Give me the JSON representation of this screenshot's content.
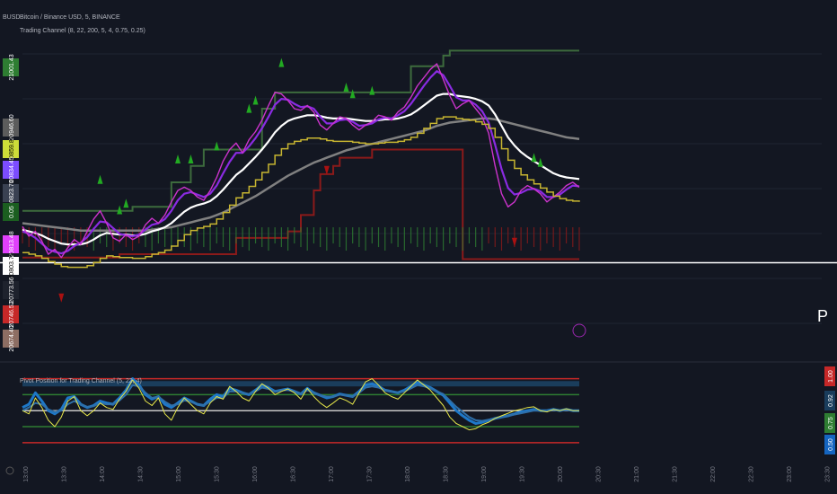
{
  "header": {
    "symbol_code": "BUSD",
    "title": "Bitcoin / Binance USD, 5, BINANCE",
    "indicator": "Trading Channel (8, 22, 200, 5, 4, 0.75, 0.25)",
    "osc_title": "Pivot Position for Trading Channel (5, 22, 4)",
    "p_mark": "P"
  },
  "colors": {
    "background": "#131722",
    "grid": "#1f2633",
    "price": "#ffffff",
    "magenta": "#cc33cc",
    "purple": "#8a2be2",
    "gold": "#c7b531",
    "gray": "#808080",
    "green_level": "#3d6b3d",
    "red_level": "#8b1a1a",
    "brown_level": "#a07878",
    "arrow_up": "#22aa22",
    "arrow_down": "#aa1111",
    "osc_blue": "#1e78c8",
    "osc_yellow": "#e6e64a",
    "osc_white": "#c8c8c8"
  },
  "price_tags": [
    {
      "text": "21001.43",
      "bg": "#2e7d32",
      "fg": "#ffffff"
    },
    {
      "text": "20946.60",
      "bg": "#5c5c5c",
      "fg": "#ffffff"
    },
    {
      "text": "20859.87",
      "bg": "#cddc39",
      "fg": "#000000"
    },
    {
      "text": "20834.45",
      "bg": "#7c4dff",
      "fg": "#ffffff"
    },
    {
      "text": "20823.76",
      "bg": "#3a4152",
      "fg": "#ffffff"
    },
    {
      "text": "0.05",
      "bg": "#1b5e20",
      "fg": "#ffffff"
    },
    {
      "text": "20813.48",
      "bg": "#e040fb",
      "fg": "#ffffff"
    },
    {
      "text": "20803.75",
      "bg": "#ffffff",
      "fg": "#000000"
    },
    {
      "text": "20773.56",
      "bg": "#1e222d",
      "fg": "#ffffff"
    },
    {
      "text": "20746.52",
      "bg": "#c62828",
      "fg": "#ffffff"
    },
    {
      "text": "20674.40",
      "bg": "#8d6e63",
      "fg": "#ffffff"
    }
  ],
  "osc_tags": [
    {
      "text": "1.00",
      "bg": "#c62828",
      "fg": "#ffffff"
    },
    {
      "text": "0.92",
      "bg": "#1a3d5c",
      "fg": "#ffffff"
    },
    {
      "text": "0.75",
      "bg": "#2e7d32",
      "fg": "#ffffff"
    },
    {
      "text": "0.50",
      "bg": "#1565c0",
      "fg": "#ffffff"
    }
  ],
  "chart_data": {
    "type": "line",
    "title": "Bitcoin / Binance USD, 5, BINANCE",
    "x_ticks": [
      "13:00",
      "13:30",
      "14:00",
      "14:30",
      "15:00",
      "15:30",
      "16:00",
      "16:30",
      "17:00",
      "17:30",
      "18:00",
      "18:30",
      "19:00",
      "19:30",
      "20:00",
      "20:30",
      "21:00",
      "21:30",
      "22:00",
      "22:30",
      "23:00",
      "23:30"
    ],
    "x": [
      0,
      5,
      10,
      15,
      20,
      25,
      30,
      35,
      40,
      45,
      50,
      55,
      60,
      65,
      70,
      75,
      80,
      85,
      90,
      95,
      100,
      105,
      110,
      115,
      120,
      125,
      130,
      135,
      140,
      145,
      150,
      155,
      160,
      165,
      170,
      175,
      180,
      185,
      190,
      195,
      200,
      205,
      210,
      215,
      220,
      225,
      230,
      235,
      240,
      245,
      250,
      255,
      260,
      265,
      270,
      275,
      280,
      285,
      290,
      295,
      300,
      305,
      310,
      315,
      320,
      325,
      330,
      335,
      340,
      345,
      350,
      355,
      360,
      365,
      370,
      375,
      380,
      385,
      390,
      395,
      400,
      405,
      410,
      415,
      420,
      425,
      430
    ],
    "price_ylim": [
      20640,
      21030
    ],
    "series": [
      {
        "name": "price",
        "values": [
          20786,
          20774,
          20780,
          20768,
          20752,
          20758,
          20748,
          20760,
          20770,
          20764,
          20780,
          20795,
          20805,
          20790,
          20772,
          20768,
          20776,
          20770,
          20774,
          20788,
          20796,
          20790,
          20800,
          20816,
          20830,
          20834,
          20830,
          20822,
          20818,
          20830,
          20846,
          20866,
          20880,
          20888,
          20876,
          20892,
          20902,
          20916,
          20934,
          20950,
          20948,
          20940,
          20930,
          20928,
          20934,
          20926,
          20910,
          20904,
          20912,
          20920,
          20918,
          20910,
          20904,
          20910,
          20914,
          20922,
          20920,
          20916,
          20926,
          20932,
          20944,
          20958,
          20968,
          20978,
          20985,
          20966,
          20946,
          20930,
          20936,
          20940,
          20930,
          20920,
          20900,
          20860,
          20826,
          20810,
          20816,
          20830,
          20836,
          20832,
          20826,
          20816,
          20822,
          20828,
          20836,
          20840,
          20834
        ]
      },
      {
        "name": "ema-fast",
        "values": [
          20780,
          20777,
          20772,
          20765,
          20758,
          20755,
          20753,
          20756,
          20762,
          20766,
          20773,
          20783,
          20792,
          20791,
          20784,
          20777,
          20775,
          20774,
          20776,
          20782,
          20788,
          20790,
          20795,
          20805,
          20818,
          20826,
          20828,
          20825,
          20822,
          20826,
          20836,
          20851,
          20865,
          20876,
          20876,
          20884,
          20894,
          20906,
          20920,
          20935,
          20942,
          20941,
          20936,
          20932,
          20933,
          20930,
          20920,
          20912,
          20912,
          20916,
          20917,
          20914,
          20909,
          20910,
          20912,
          20917,
          20919,
          20918,
          20922,
          20927,
          20936,
          20947,
          20958,
          20968,
          20976,
          20971,
          20958,
          20944,
          20940,
          20940,
          20935,
          20927,
          20913,
          20886,
          20856,
          20833,
          20825,
          20827,
          20831,
          20832,
          20829,
          20822,
          20822,
          20825,
          20831,
          20836,
          20835
        ]
      },
      {
        "name": "ema-mid",
        "values": [
          20782,
          20780,
          20778,
          20775,
          20771,
          20768,
          20765,
          20764,
          20764,
          20764,
          20766,
          20770,
          20775,
          20778,
          20777,
          20776,
          20776,
          20775,
          20775,
          20777,
          20780,
          20782,
          20785,
          20790,
          20797,
          20804,
          20809,
          20812,
          20814,
          20817,
          20823,
          20831,
          20840,
          20849,
          20855,
          20863,
          20871,
          20880,
          20890,
          20901,
          20909,
          20915,
          20918,
          20920,
          20922,
          20922,
          20921,
          20919,
          20918,
          20918,
          20918,
          20917,
          20916,
          20915,
          20915,
          20916,
          20917,
          20917,
          20918,
          20920,
          20923,
          20928,
          20934,
          20940,
          20946,
          20948,
          20948,
          20946,
          20945,
          20944,
          20942,
          20939,
          20934,
          20923,
          20909,
          20895,
          20885,
          20877,
          20871,
          20866,
          20861,
          20856,
          20851,
          20848,
          20846,
          20845,
          20844
        ]
      },
      {
        "name": "ema-slow",
        "values": [
          20790,
          20789,
          20788,
          20787,
          20786,
          20785,
          20784,
          20783,
          20782,
          20781,
          20781,
          20781,
          20781,
          20781,
          20781,
          20781,
          20781,
          20781,
          20781,
          20781,
          20782,
          20783,
          20784,
          20785,
          20787,
          20789,
          20791,
          20793,
          20795,
          20797,
          20800,
          20803,
          20807,
          20811,
          20815,
          20819,
          20823,
          20828,
          20833,
          20838,
          20843,
          20848,
          20852,
          20856,
          20860,
          20864,
          20867,
          20870,
          20873,
          20876,
          20879,
          20881,
          20883,
          20885,
          20887,
          20889,
          20891,
          20893,
          20895,
          20897,
          20899,
          20901,
          20903,
          20906,
          20909,
          20911,
          20913,
          20914,
          20915,
          20916,
          20917,
          20918,
          20918,
          20917,
          20915,
          20913,
          20911,
          20909,
          20907,
          20905,
          20903,
          20901,
          20899,
          20897,
          20895,
          20894,
          20893
        ]
      }
    ],
    "levels": [
      {
        "name": "upper-green",
        "values": [
          20805,
          20805,
          20805,
          20805,
          20805,
          20805,
          20805,
          20805,
          20805,
          20805,
          20805,
          20805,
          20805,
          20805,
          20805,
          20805,
          20805,
          20810,
          20810,
          20810,
          20810,
          20810,
          20810,
          20840,
          20840,
          20840,
          20860,
          20860,
          20880,
          20880,
          20880,
          20880,
          20880,
          20880,
          20880,
          20880,
          20880,
          20930,
          20930,
          20950,
          20950,
          20950,
          20950,
          20950,
          20950,
          20950,
          20950,
          20950,
          20950,
          20950,
          20950,
          20950,
          20950,
          20950,
          20950,
          20950,
          20950,
          20950,
          20950,
          20950,
          20982,
          20982,
          20982,
          20982,
          20982,
          20995,
          21001,
          21001,
          21001,
          21001,
          21001,
          21001,
          21001,
          21001,
          21001,
          21001,
          21001,
          21001,
          21001,
          21001,
          21001,
          21001,
          21001,
          21001,
          21001,
          21001,
          21001
        ]
      },
      {
        "name": "lower-red",
        "values": [
          20748,
          20748,
          20748,
          20748,
          20748,
          20748,
          20748,
          20748,
          20748,
          20748,
          20748,
          20748,
          20748,
          20748,
          20748,
          20752,
          20752,
          20752,
          20752,
          20752,
          20752,
          20752,
          20752,
          20752,
          20752,
          20752,
          20752,
          20752,
          20752,
          20752,
          20752,
          20752,
          20752,
          20772,
          20772,
          20772,
          20772,
          20772,
          20772,
          20772,
          20772,
          20780,
          20780,
          20800,
          20800,
          20830,
          20850,
          20850,
          20860,
          20870,
          20870,
          20870,
          20870,
          20870,
          20880,
          20880,
          20880,
          20880,
          20880,
          20880,
          20880,
          20880,
          20880,
          20880,
          20880,
          20880,
          20880,
          20880,
          20746,
          20746,
          20746,
          20746,
          20746,
          20746,
          20746,
          20746,
          20746,
          20746,
          20746,
          20746,
          20746,
          20746,
          20746,
          20746,
          20746,
          20746,
          20746
        ]
      }
    ],
    "signals": [
      {
        "x": 30,
        "dir": "down"
      },
      {
        "x": 60,
        "dir": "up"
      },
      {
        "x": 75,
        "dir": "up"
      },
      {
        "x": 80,
        "dir": "up"
      },
      {
        "x": 120,
        "dir": "up"
      },
      {
        "x": 130,
        "dir": "up"
      },
      {
        "x": 150,
        "dir": "up"
      },
      {
        "x": 175,
        "dir": "up"
      },
      {
        "x": 180,
        "dir": "up"
      },
      {
        "x": 200,
        "dir": "up"
      },
      {
        "x": 235,
        "dir": "down"
      },
      {
        "x": 250,
        "dir": "up"
      },
      {
        "x": 255,
        "dir": "up"
      },
      {
        "x": 270,
        "dir": "up"
      },
      {
        "x": 380,
        "dir": "down"
      },
      {
        "x": 395,
        "dir": "up"
      },
      {
        "x": 400,
        "dir": "up"
      }
    ],
    "oscillator": {
      "ylim": [
        -0.1,
        1.05
      ],
      "levels": [
        1.0,
        0.92,
        0.75,
        0.5,
        0.25,
        0.0
      ],
      "series": [
        {
          "name": "osc-line",
          "values": [
            0.55,
            0.6,
            0.78,
            0.65,
            0.5,
            0.45,
            0.52,
            0.7,
            0.72,
            0.6,
            0.55,
            0.58,
            0.65,
            0.62,
            0.6,
            0.7,
            0.82,
            1.0,
            0.9,
            0.75,
            0.68,
            0.72,
            0.6,
            0.55,
            0.62,
            0.7,
            0.65,
            0.6,
            0.58,
            0.68,
            0.75,
            0.72,
            0.85,
            0.82,
            0.78,
            0.75,
            0.82,
            0.9,
            0.86,
            0.8,
            0.82,
            0.84,
            0.8,
            0.76,
            0.85,
            0.78,
            0.74,
            0.7,
            0.72,
            0.76,
            0.74,
            0.72,
            0.8,
            0.9,
            0.92,
            0.88,
            0.82,
            0.8,
            0.78,
            0.82,
            0.88,
            0.94,
            0.9,
            0.86,
            0.8,
            0.74,
            0.62,
            0.5,
            0.42,
            0.35,
            0.3,
            0.32,
            0.35,
            0.38,
            0.4,
            0.42,
            0.45,
            0.48,
            0.5,
            0.52,
            0.5,
            0.5,
            0.52,
            0.5,
            0.52,
            0.5,
            0.5
          ]
        },
        {
          "name": "osc-signal",
          "values": [
            0.5,
            0.55,
            0.62,
            0.6,
            0.52,
            0.48,
            0.5,
            0.6,
            0.65,
            0.6,
            0.56,
            0.57,
            0.62,
            0.6,
            0.6,
            0.66,
            0.75,
            0.9,
            0.88,
            0.78,
            0.7,
            0.72,
            0.64,
            0.58,
            0.6,
            0.66,
            0.64,
            0.6,
            0.58,
            0.64,
            0.7,
            0.7,
            0.8,
            0.8,
            0.78,
            0.76,
            0.8,
            0.86,
            0.84,
            0.8,
            0.82,
            0.82,
            0.8,
            0.76,
            0.82,
            0.78,
            0.74,
            0.72,
            0.72,
            0.75,
            0.74,
            0.72,
            0.78,
            0.86,
            0.88,
            0.86,
            0.82,
            0.8,
            0.78,
            0.8,
            0.85,
            0.9,
            0.88,
            0.85,
            0.8,
            0.76,
            0.66,
            0.56,
            0.48,
            0.4,
            0.35,
            0.34,
            0.36,
            0.38,
            0.4,
            0.42,
            0.44,
            0.46,
            0.48,
            0.5,
            0.5,
            0.5,
            0.51,
            0.5,
            0.51,
            0.5,
            0.5
          ]
        },
        {
          "name": "osc-fast",
          "values": [
            0.5,
            0.45,
            0.7,
            0.55,
            0.35,
            0.25,
            0.4,
            0.65,
            0.72,
            0.5,
            0.42,
            0.5,
            0.62,
            0.55,
            0.52,
            0.68,
            0.8,
            0.98,
            0.85,
            0.65,
            0.58,
            0.7,
            0.45,
            0.35,
            0.55,
            0.7,
            0.6,
            0.5,
            0.45,
            0.62,
            0.72,
            0.68,
            0.88,
            0.8,
            0.7,
            0.65,
            0.8,
            0.92,
            0.85,
            0.75,
            0.8,
            0.84,
            0.78,
            0.68,
            0.85,
            0.72,
            0.62,
            0.55,
            0.62,
            0.7,
            0.66,
            0.6,
            0.78,
            0.95,
            1.0,
            0.9,
            0.78,
            0.72,
            0.68,
            0.78,
            0.88,
            0.98,
            0.9,
            0.82,
            0.7,
            0.58,
            0.4,
            0.3,
            0.25,
            0.2,
            0.22,
            0.28,
            0.32,
            0.38,
            0.42,
            0.46,
            0.5,
            0.52,
            0.55,
            0.56,
            0.5,
            0.48,
            0.52,
            0.5,
            0.53,
            0.5,
            0.5
          ]
        }
      ]
    }
  }
}
